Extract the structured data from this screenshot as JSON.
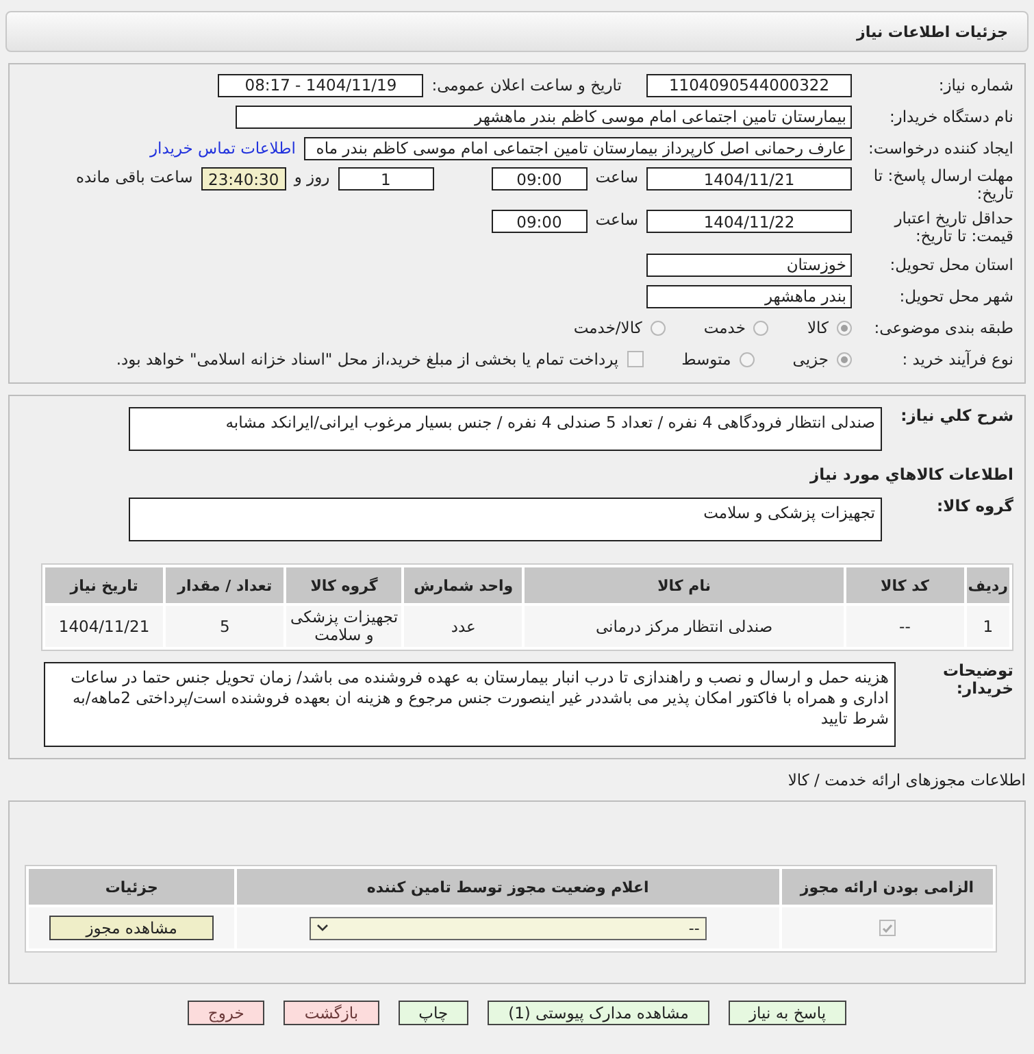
{
  "header": {
    "title": "جزئیات اطلاعات نیاز"
  },
  "need_number": {
    "label": "شماره نیاز:",
    "value": "1104090544000322"
  },
  "announce": {
    "label": "تاریخ و ساعت اعلان عمومی:",
    "value": "1404/11/19 - 08:17"
  },
  "buyer": {
    "label": "نام دستگاه خریدار:",
    "value": "بیمارستان تامین اجتماعی امام موسی کاظم بندر ماهشهر"
  },
  "creator": {
    "label": "ایجاد کننده درخواست:",
    "value": "عارف رحمانی اصل کارپرداز بیمارستان تامین اجتماعی امام موسی کاظم بندر ماه",
    "link": "اطلاعات تماس خریدار"
  },
  "deadline": {
    "label": "مهلت ارسال پاسخ: تا تاریخ:",
    "date": "1404/11/21",
    "time_label": "ساعت",
    "time": "09:00",
    "days": "1",
    "days_label": "روز و",
    "remaining": "23:40:30",
    "remaining_label": "ساعت باقی مانده"
  },
  "validity": {
    "label": "حداقل تاریخ اعتبار قیمت: تا تاریخ:",
    "date": "1404/11/22",
    "time_label": "ساعت",
    "time": "09:00"
  },
  "province": {
    "label": "استان محل تحویل:",
    "value": "خوزستان"
  },
  "city": {
    "label": "شهر محل تحویل:",
    "value": "بندر ماهشهر"
  },
  "category": {
    "label": "طبقه بندی موضوعی:",
    "options": [
      {
        "label": "کالا",
        "selected": true
      },
      {
        "label": "خدمت",
        "selected": false
      },
      {
        "label": "کالا/خدمت",
        "selected": false
      }
    ]
  },
  "process": {
    "label": "نوع فرآیند خرید :",
    "options": [
      {
        "label": "جزیی",
        "selected": true
      },
      {
        "label": "متوسط",
        "selected": false
      }
    ],
    "treasury": {
      "label": "پرداخت تمام یا بخشی از مبلغ خرید،از محل \"اسناد خزانه اسلامی\" خواهد بود.",
      "checked": false
    }
  },
  "description": {
    "label": "شرح کلي نياز:",
    "value": "صندلی انتظار فرودگاهی 4 نفره / تعداد 5 صندلی 4 نفره / جنس بسیار مرغوب ایرانی/ایرانکد مشابه"
  },
  "goods_title": "اطلاعات کالاهاي مورد نياز",
  "goods_group": {
    "label": "گروه کالا:",
    "value": "تجهیزات پزشکی و سلامت"
  },
  "goods_table": {
    "columns": [
      "ردیف",
      "کد کالا",
      "نام کالا",
      "واحد شمارش",
      "گروه کالا",
      "تعداد / مقدار",
      "تاریخ نیاز"
    ],
    "rows": [
      [
        "1",
        "--",
        "صندلی انتظار مرکز درمانی",
        "عدد",
        "تجهیزات پزشکی و سلامت",
        "5",
        "1404/11/21"
      ]
    ]
  },
  "buyer_notes": {
    "label": "توضیحات خریدار:",
    "value": "هزینه حمل و ارسال و نصب و راهندازی  تا درب انبار بیمارستان به عهده فروشنده می باشد/ زمان تحویل جنس حتما در ساعات اداری و همراه با فاکتور امکان پذیر می باشددر غیر اینصورت جنس مرجوع و هزینه ان بعهده فروشنده است/پرداختی 2ماهه/به شرط تایید"
  },
  "permits": {
    "title": "اطلاعات مجوزهای ارائه خدمت / کالا",
    "columns": [
      "الزامی بودن ارائه مجوز",
      "اعلام وضعیت مجوز توسط تامین کننده",
      "جزئیات"
    ],
    "rows": [
      {
        "required": true,
        "status": "--",
        "button": "مشاهده مجوز"
      }
    ]
  },
  "buttons": [
    {
      "label": "پاسخ به نیاز",
      "kind": "normal"
    },
    {
      "label": "مشاهده مدارک پیوستی (1)",
      "kind": "normal"
    },
    {
      "label": "چاپ",
      "kind": "normal"
    },
    {
      "label": "بازگشت",
      "kind": "alert"
    },
    {
      "label": "خروج",
      "kind": "alert"
    }
  ]
}
